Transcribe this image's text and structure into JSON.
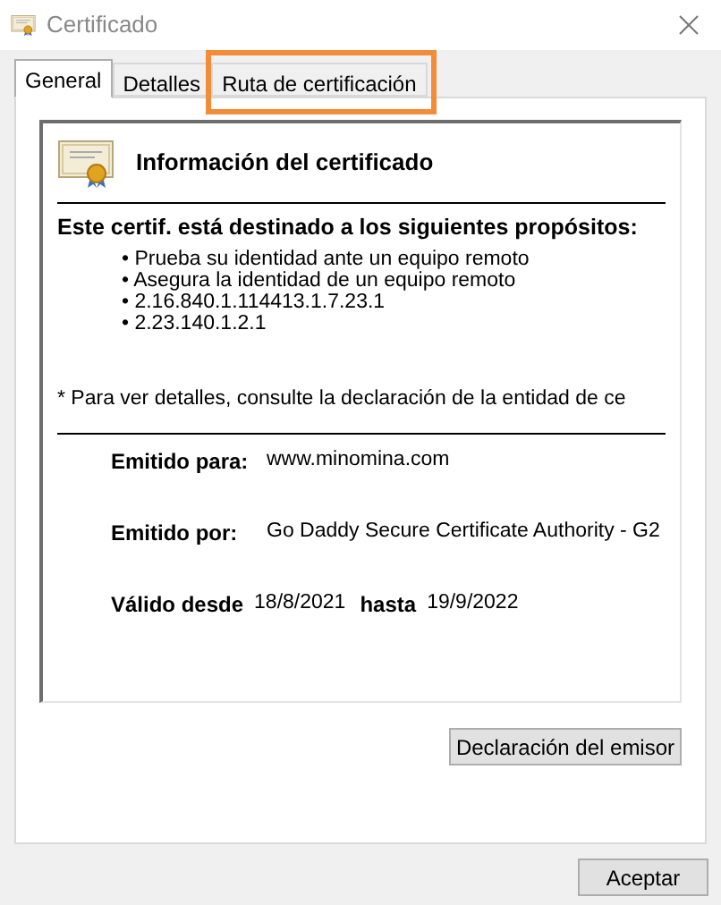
{
  "window": {
    "title": "Certificado"
  },
  "tabs": [
    {
      "label": "General",
      "selected": true,
      "highlighted": false
    },
    {
      "label": "Detalles",
      "selected": false,
      "highlighted": false
    },
    {
      "label": "Ruta de certificación",
      "selected": false,
      "highlighted": true
    }
  ],
  "info": {
    "heading": "Información del certificado",
    "purposes_title": "Este certif. está destinado a los siguientes propósitos:",
    "purposes": [
      "• Prueba su identidad ante un equipo remoto",
      "• Asegura la identidad de un equipo remoto",
      "• 2.16.840.1.114413.1.7.23.1",
      "• 2.23.140.1.2.1"
    ],
    "note": "* Para ver detalles, consulte la declaración de la entidad de ce"
  },
  "fields": [
    {
      "label": "Emitido para:",
      "value": "www.minomina.com"
    },
    {
      "label": "Emitido por:",
      "value": "Go Daddy Secure Certificate Authority - G2"
    }
  ],
  "validity": {
    "from_label": "Válido desde",
    "from": "18/8/2021",
    "to_label": "hasta",
    "to": "19/9/2022"
  },
  "panel_button": "Declaración del emisor",
  "ok_button": "Aceptar"
}
